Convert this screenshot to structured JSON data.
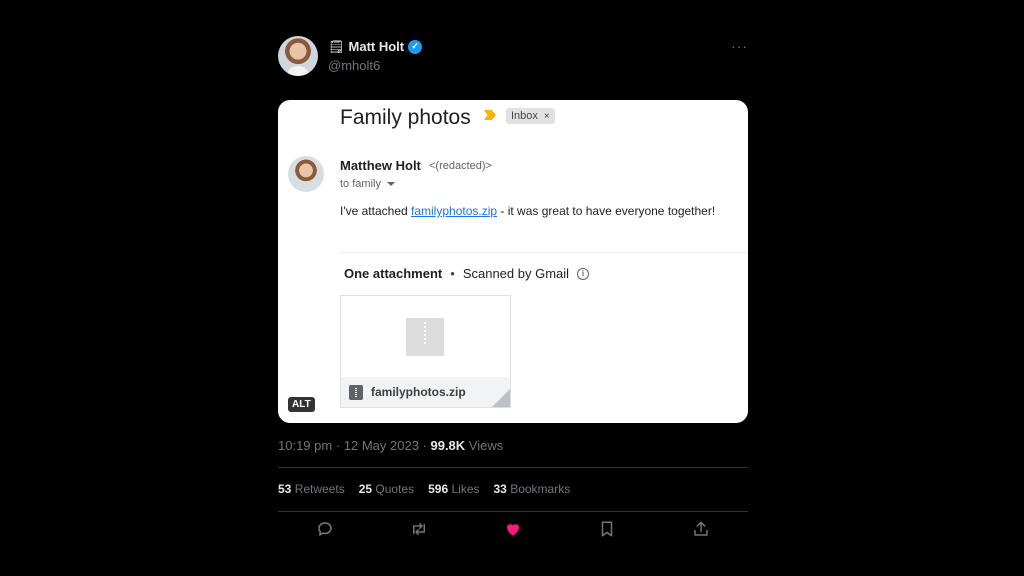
{
  "author": {
    "emoji": "🗒",
    "name": "Matt Holt",
    "verified_mark": "✓",
    "handle": "@mholt6",
    "more_label": "···"
  },
  "media": {
    "subject": "Family photos",
    "inbox_chip": "Inbox",
    "chip_close": "×",
    "sender_name": "Matthew Holt",
    "sender_email": "<(redacted)>",
    "to_label": "to family",
    "body_before": "I've attached ",
    "body_link": "familyphotos.zip",
    "body_after": " - it was great to have everyone together!",
    "attachment_title": "One attachment",
    "dot": "•",
    "scanned_label": "Scanned by Gmail",
    "info_symbol": "i",
    "file_name": "familyphotos.zip",
    "alt_label": "ALT"
  },
  "meta": {
    "time_date": "10:19 pm · 12 May 2023 · ",
    "views_count": "99.8K",
    "views_label": " Views"
  },
  "stats": {
    "retweets_count": "53",
    "retweets_label": " Retweets",
    "quotes_count": "25",
    "quotes_label": " Quotes",
    "likes_count": "596",
    "likes_label": " Likes",
    "bookmarks_count": "33",
    "bookmarks_label": " Bookmarks"
  },
  "colors": {
    "background": "#000000",
    "like_active": "#f91880",
    "icon_gray": "#71767b",
    "verified": "#1d9bf0",
    "link": "#1a73e8"
  }
}
